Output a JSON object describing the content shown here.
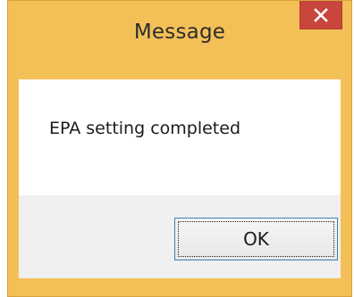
{
  "dialog": {
    "title": "Message",
    "close_icon": "close-icon",
    "message": "EPA setting completed",
    "ok_label": "OK",
    "colors": {
      "frame": "#f3c058",
      "close_button": "#c9463d",
      "content_bg": "#ffffff",
      "footer_bg": "#f0f0f0",
      "button_border": "#3c7fb1"
    }
  }
}
